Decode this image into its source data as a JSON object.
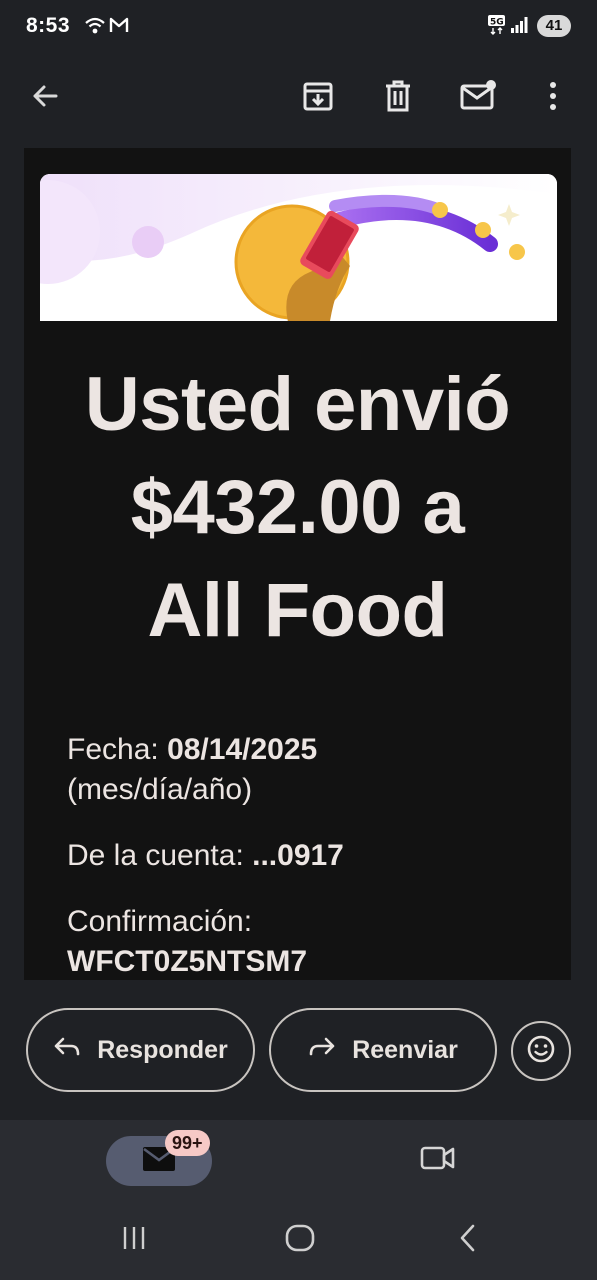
{
  "status_bar": {
    "time": "8:53",
    "network": "5G",
    "battery": "41"
  },
  "toolbar": {
    "back_icon": "arrow-left-icon",
    "archive_icon": "archive-icon",
    "delete_icon": "trash-icon",
    "mark_unread_icon": "mail-unread-icon",
    "more_icon": "more-vertical-icon"
  },
  "email": {
    "headline_line1": "Usted envió",
    "headline_line2": "$432.00 a",
    "headline_line3": "All Food",
    "date_label": "Fecha: ",
    "date_value": "08/14/2025",
    "date_format": "(mes/día/año)",
    "account_label": "De la cuenta: ",
    "account_value": "...0917",
    "confirmation_label": "Confirmación:",
    "confirmation_value": "WFCT0Z5NTSM7"
  },
  "actions": {
    "reply_label": "Responder",
    "forward_label": "Reenviar",
    "emoji_icon": "emoji-smile-icon"
  },
  "bottom_nav": {
    "mail_badge": "99+",
    "mail_icon": "mail-icon",
    "meet_icon": "video-camera-icon"
  },
  "colors": {
    "background": "#1f2125",
    "email_body": "#121212",
    "text": "#ece5e2",
    "badge": "#f6c9c6"
  }
}
